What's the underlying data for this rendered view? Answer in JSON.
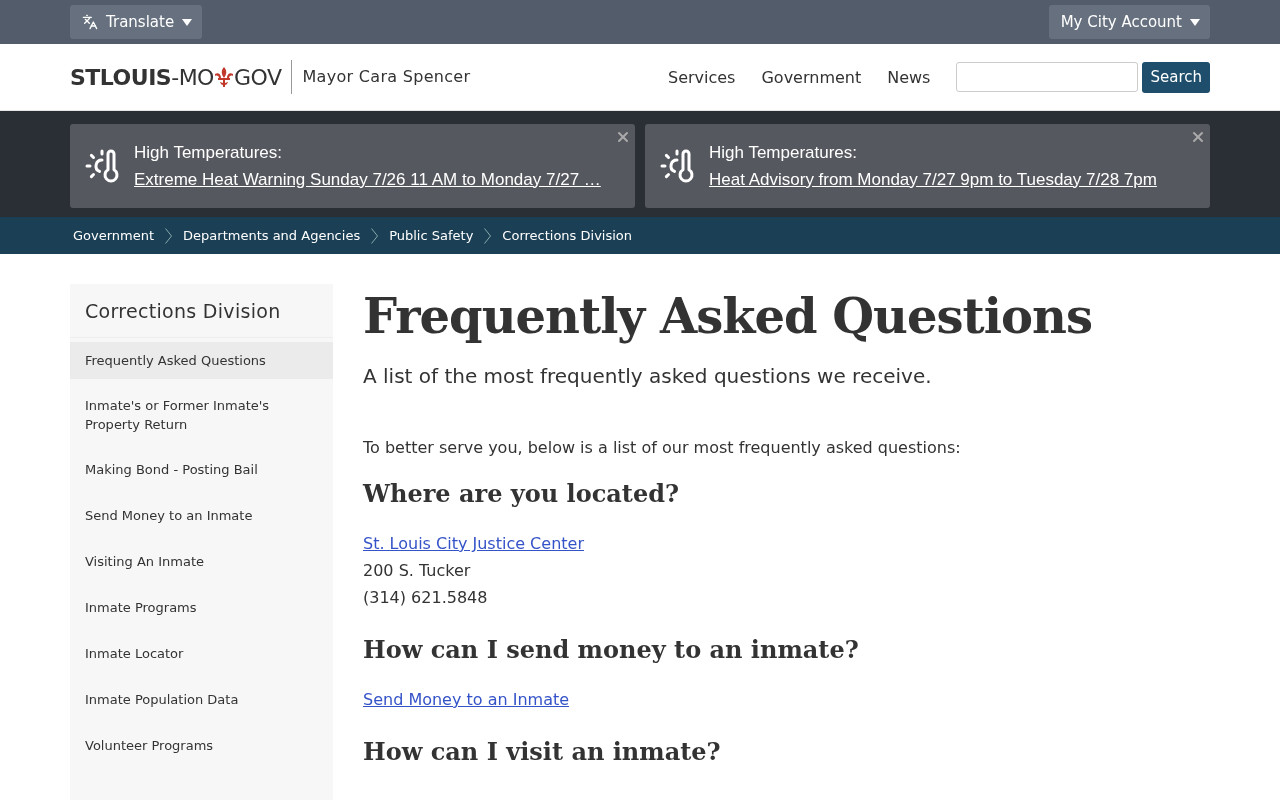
{
  "utility_bar": {
    "translate": "Translate",
    "account": "My City Account"
  },
  "header": {
    "logo_main": "**STLOUIS**-MO",
    "logo_suffix": "GOV",
    "tagline": "Mayor Cara Spencer",
    "nav": [
      "Services",
      "Government",
      "News"
    ],
    "search_button": "Search"
  },
  "alerts": [
    {
      "title": "High Temperatures:",
      "link": "Extreme Heat Warning Sunday 7/26 11 AM to Monday 7/27 …"
    },
    {
      "title": "High Temperatures:",
      "link": "Heat Advisory from Monday 7/27 9pm to Tuesday 7/28 7pm"
    }
  ],
  "breadcrumbs": [
    "Government",
    "Departments and Agencies",
    "Public Safety",
    "Corrections Division"
  ],
  "sidebar": {
    "title": "Corrections Division",
    "items": [
      {
        "label": "Frequently Asked Questions",
        "selected": true
      },
      {
        "label": "Inmate's or Former Inmate's Property Return",
        "selected": false
      },
      {
        "label": "Making Bond - Posting Bail",
        "selected": false
      },
      {
        "label": "Send Money to an Inmate",
        "selected": false
      },
      {
        "label": "Visiting An Inmate",
        "selected": false
      },
      {
        "label": "Inmate Programs",
        "selected": false
      },
      {
        "label": "Inmate Locator",
        "selected": false
      },
      {
        "label": "Inmate Population Data",
        "selected": false
      },
      {
        "label": "Volunteer Programs",
        "selected": false
      }
    ]
  },
  "content": {
    "title": "Frequently Asked Questions",
    "lead": "A list of the most frequently asked questions we receive.",
    "blocks": [
      {
        "kind": "paragraph",
        "text": "To better serve you, below is a list of our most frequently asked questions:"
      },
      {
        "kind": "heading",
        "text": "Where are you located?"
      },
      {
        "kind": "link",
        "text": "St. Louis City Justice Center"
      },
      {
        "kind": "line",
        "text": "200 S. Tucker"
      },
      {
        "kind": "line",
        "text": "(314) 621.5848"
      },
      {
        "kind": "heading",
        "text": "How can I send money to an inmate?"
      },
      {
        "kind": "link",
        "text": "Send Money to an Inmate"
      },
      {
        "kind": "heading",
        "text": "How can I visit an inmate?"
      }
    ]
  }
}
